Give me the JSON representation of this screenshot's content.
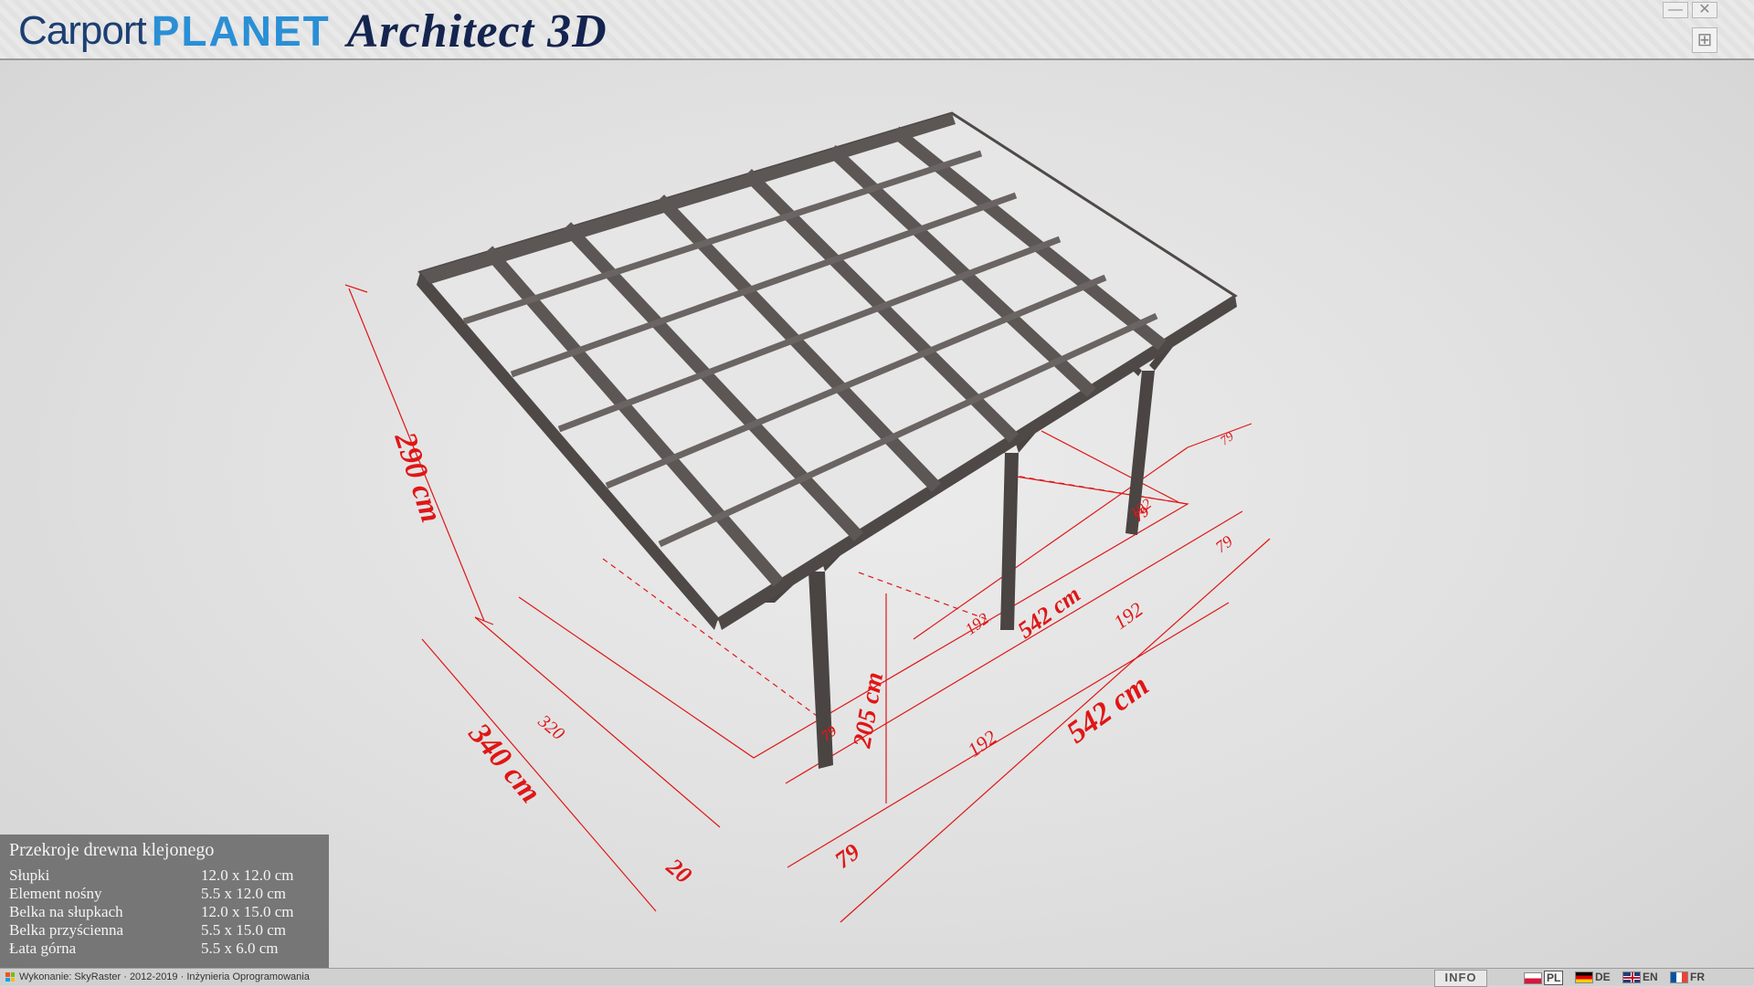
{
  "app": {
    "logo_carport": "Carport",
    "logo_planet": "PLANET",
    "logo_architect": "Architect 3D",
    "window_controls": {
      "minimize": "—",
      "close": "✕",
      "expand": "⊞"
    }
  },
  "dimensions": {
    "height_total": "290 cm",
    "depth_total": "340 cm",
    "depth_inner": "320",
    "depth_overhang": "20",
    "width_total": "542 cm",
    "width_back": "542 cm",
    "post_height": "205 cm",
    "overhang_front_left": "79",
    "overhang_front_right": "79",
    "overhang_back_right": "79",
    "span_1": "192",
    "span_2": "192",
    "span_back_left": "192",
    "span_back_right": "192",
    "post_marker_1": "79",
    "post_marker_2": "79"
  },
  "info_panel": {
    "title": "Przekroje drewna klejonego",
    "rows": [
      {
        "label": "Słupki",
        "value": "12.0 x 12.0 cm"
      },
      {
        "label": "Element nośny",
        "value": "5.5 x 12.0 cm"
      },
      {
        "label": "Belka na słupkach",
        "value": "12.0 x 15.0 cm"
      },
      {
        "label": "Belka przyścienna",
        "value": "5.5 x 15.0 cm"
      },
      {
        "label": "Łata górna",
        "value": "5.5 x 6.0 cm"
      }
    ]
  },
  "status": {
    "credit": "Wykonanie: SkyRaster · 2012-2019 · Inżynieria Oprogramowania",
    "info_button": "INFO",
    "languages": [
      {
        "code": "PL",
        "active": true
      },
      {
        "code": "DE",
        "active": false
      },
      {
        "code": "EN",
        "active": false
      },
      {
        "code": "FR",
        "active": false
      }
    ]
  },
  "colors": {
    "dimension_red": "#e01616",
    "wood": "#5c5654",
    "panel_glass": "#e6e6e6",
    "brand_navy": "#1c3f73",
    "brand_blue": "#2a8fd6"
  }
}
